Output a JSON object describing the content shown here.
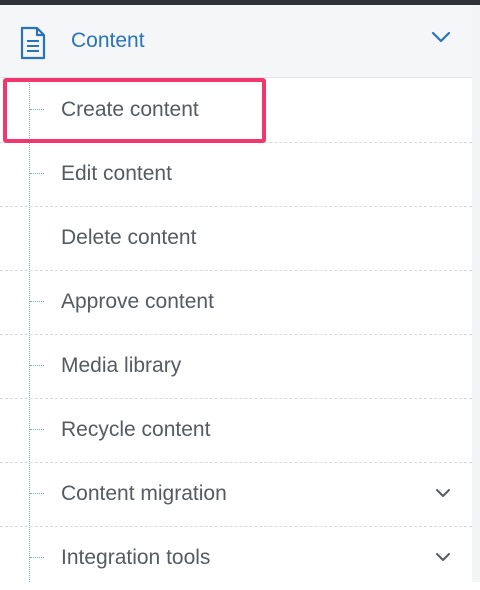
{
  "section": {
    "title": "Content",
    "icon": "document-icon",
    "accent_color": "#2a73b8",
    "expanded": true
  },
  "menu": {
    "items": [
      {
        "label": "Create content",
        "connector": true,
        "has_submenu": false,
        "highlighted": true
      },
      {
        "label": "Edit content",
        "connector": true,
        "has_submenu": false,
        "highlighted": false
      },
      {
        "label": "Delete content",
        "connector": false,
        "has_submenu": false,
        "highlighted": false
      },
      {
        "label": "Approve content",
        "connector": true,
        "has_submenu": false,
        "highlighted": false
      },
      {
        "label": "Media library",
        "connector": true,
        "has_submenu": false,
        "highlighted": false
      },
      {
        "label": "Recycle content",
        "connector": true,
        "has_submenu": false,
        "highlighted": false
      },
      {
        "label": "Content migration",
        "connector": true,
        "has_submenu": true,
        "highlighted": false
      },
      {
        "label": "Integration tools",
        "connector": true,
        "has_submenu": true,
        "highlighted": false
      }
    ]
  },
  "highlight_color": "#f0386e"
}
